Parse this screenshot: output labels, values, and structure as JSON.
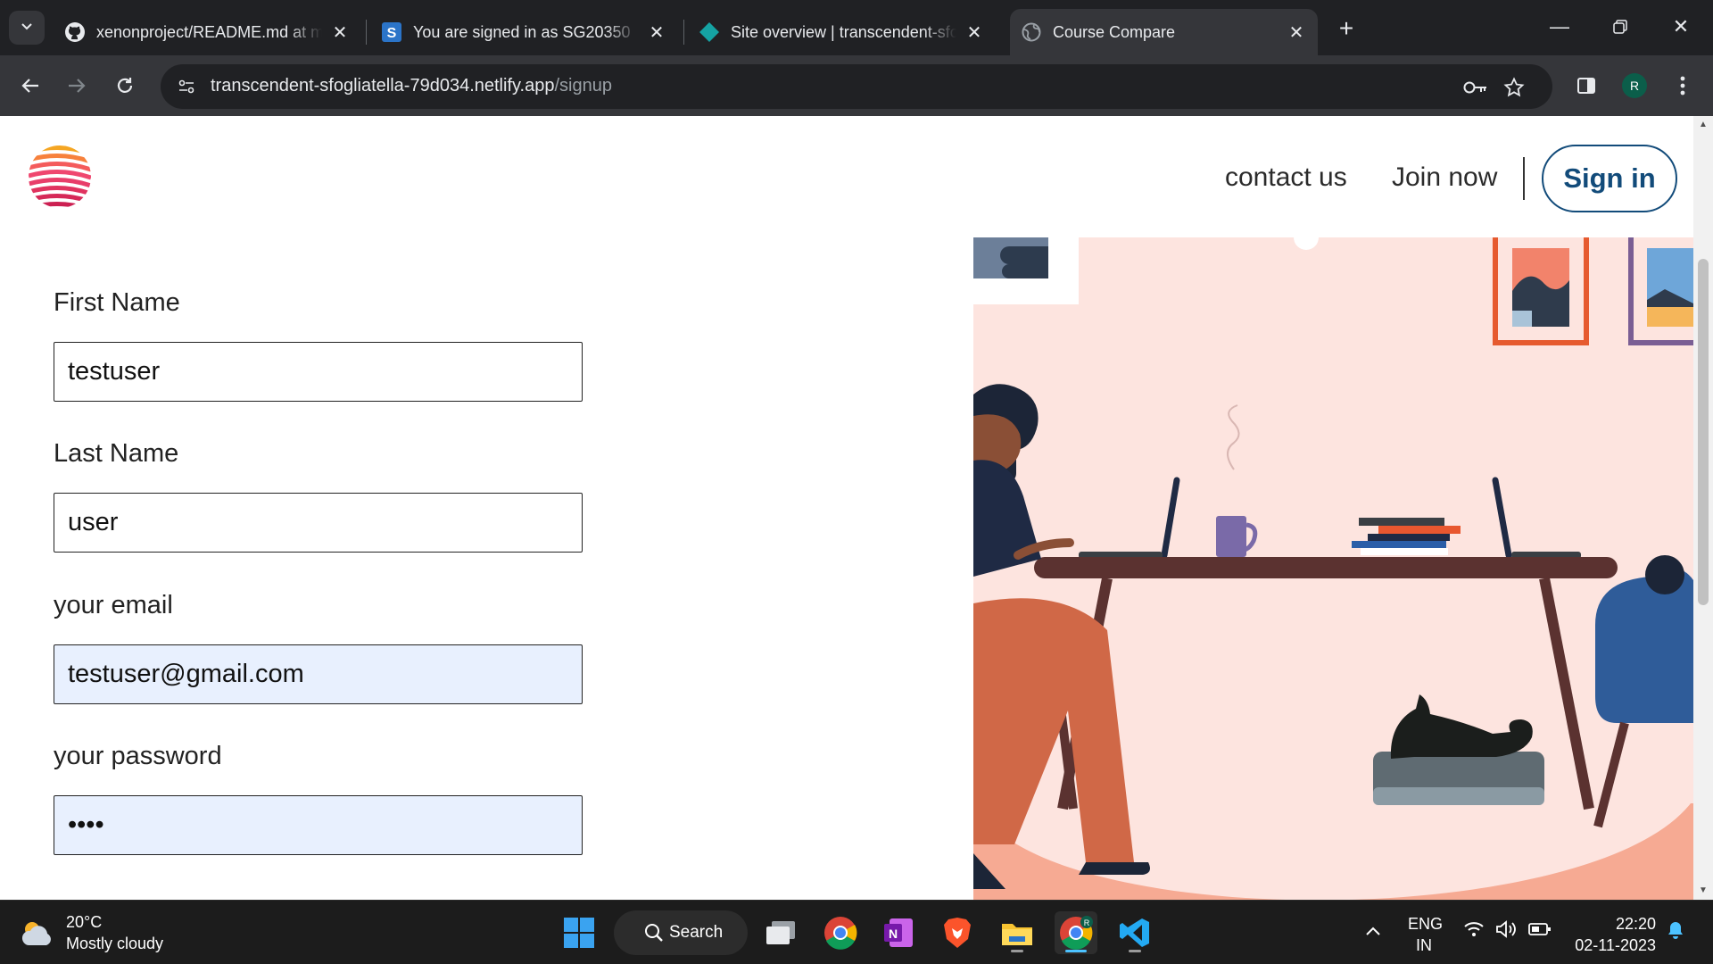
{
  "tabs": [
    {
      "title": "xenonproject/README.md at main",
      "favicon": "github-icon"
    },
    {
      "title": "You are signed in as SG20350",
      "favicon": "s-icon"
    },
    {
      "title": "Site overview | transcendent-sfogliatella",
      "favicon": "netlify-icon"
    },
    {
      "title": "Course Compare",
      "favicon": "globe-icon",
      "active": true
    }
  ],
  "toolbar": {
    "url_host": "transcendent-sfogliatella-79d034.netlify.app",
    "url_path": "/signup",
    "profile_initial": "R"
  },
  "site": {
    "nav": {
      "contact": "contact us",
      "join": "Join now",
      "signin": "Sign in"
    },
    "form": {
      "first_name_label": "First Name",
      "first_name_value": "testuser",
      "last_name_label": "Last Name",
      "last_name_value": "user",
      "email_label": "your email",
      "email_value": "testuser@gmail.com",
      "password_label": "your password",
      "password_value": "test"
    }
  },
  "taskbar": {
    "weather_temp": "20°C",
    "weather_desc": "Mostly cloudy",
    "search_label": "Search",
    "lang_line1": "ENG",
    "lang_line2": "IN",
    "time": "22:20",
    "date": "02-11-2023"
  },
  "colors": {
    "signin_accent": "#124b7a",
    "autofill_bg": "#e8f0fe",
    "illus_bg": "#fde4df"
  }
}
